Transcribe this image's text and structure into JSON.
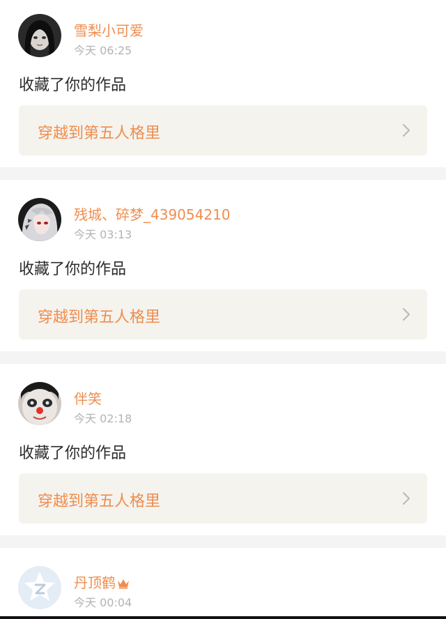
{
  "notifications": [
    {
      "username": "雪梨小可爱",
      "time": "今天 06:25",
      "action": "收藏了你的作品",
      "work_title": "穿越到第五人格里",
      "avatar": "dark-hair-avatar"
    },
    {
      "username": "残城、碎梦_439054210",
      "time": "今天 03:13",
      "action": "收藏了你的作品",
      "work_title": "穿越到第五人格里",
      "avatar": "silver-hair-anime-avatar"
    },
    {
      "username": "伴笑",
      "time": "今天 02:18",
      "action": "收藏了你的作品",
      "work_title": "穿越到第五人格里",
      "avatar": "clown-face-avatar"
    },
    {
      "username": "丹顶鹤",
      "time": "今天 00:04",
      "avatar": "default-star-avatar",
      "badge_icon": "crown-icon"
    }
  ],
  "colors": {
    "accent": "#ef8d4e",
    "muted": "#b3b3b3",
    "link_bg": "#f5f3ee",
    "separator": "#f4f4f4"
  }
}
